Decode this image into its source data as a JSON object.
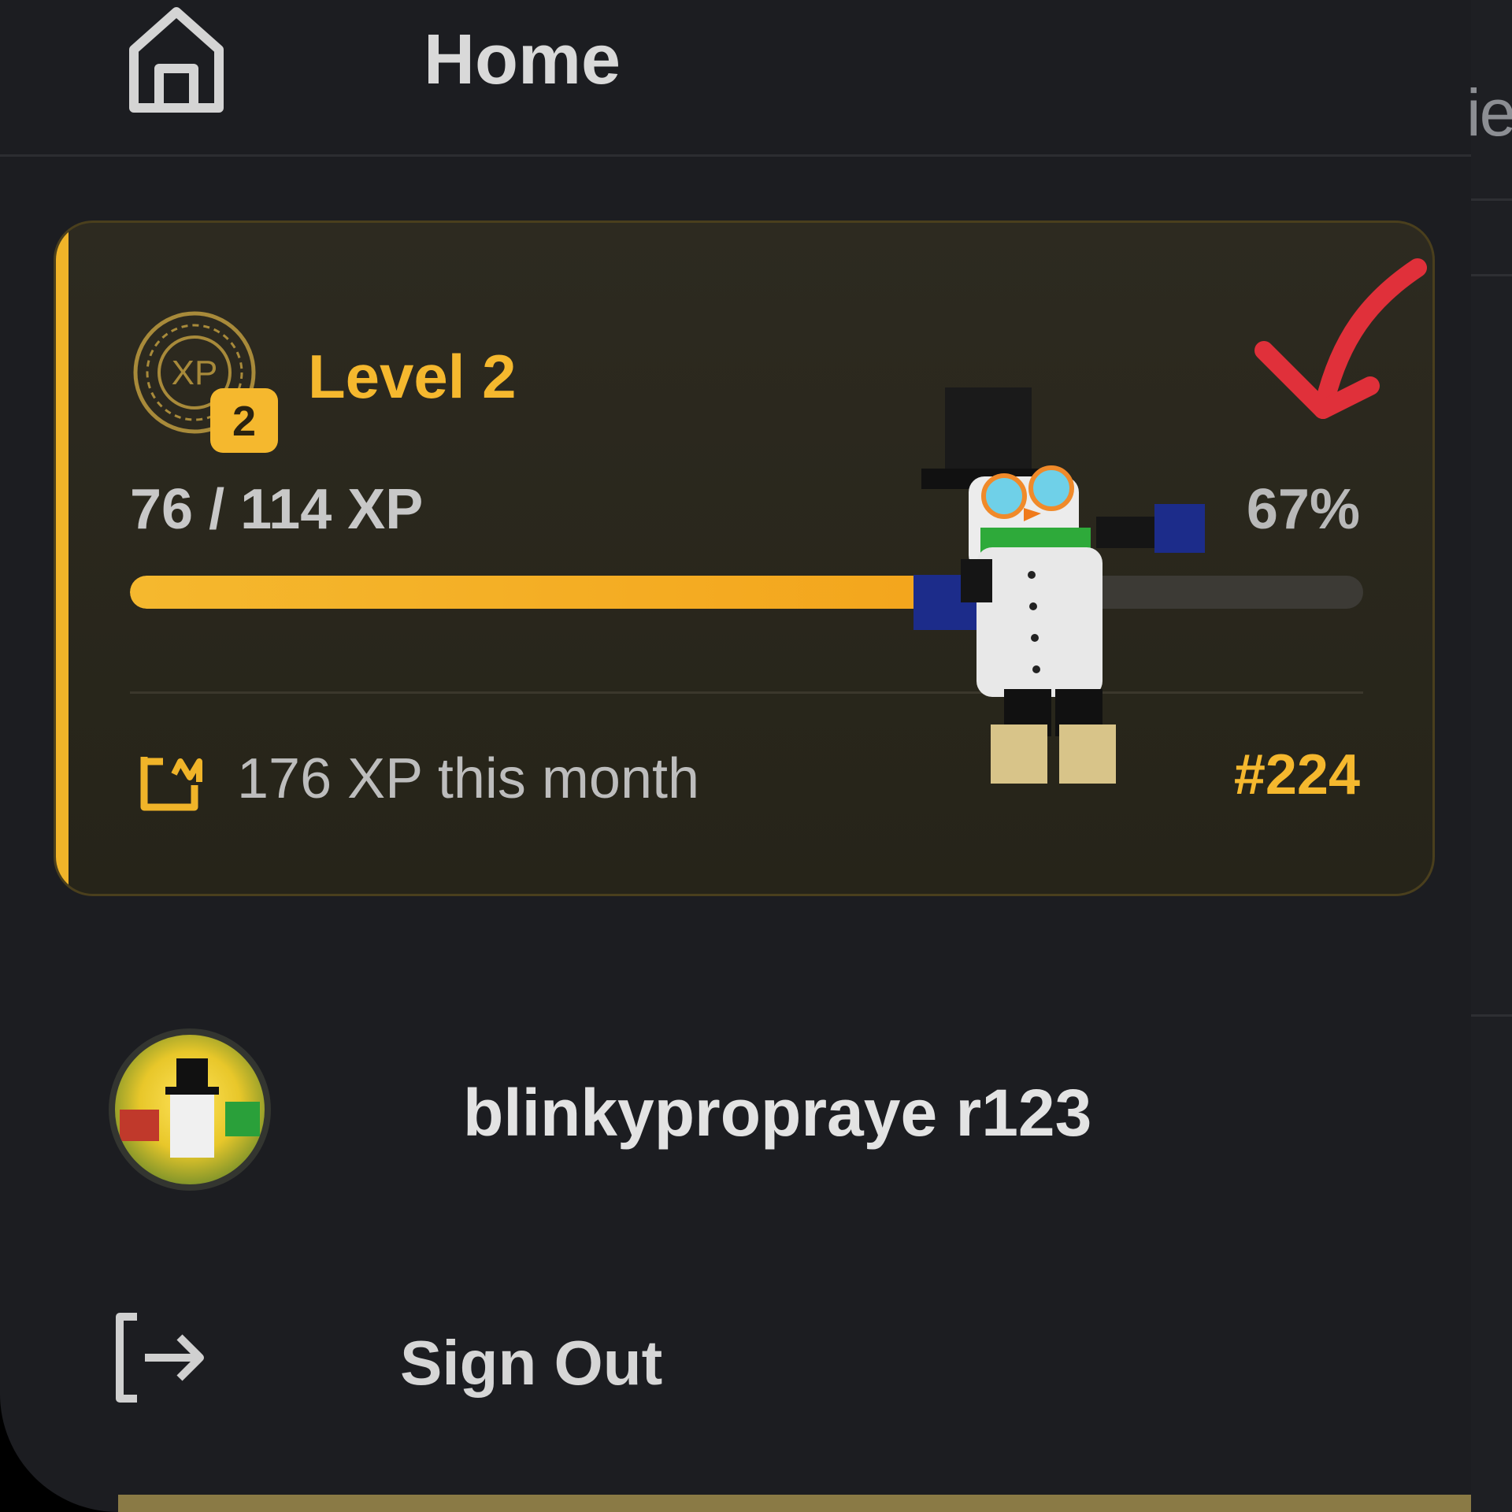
{
  "nav": {
    "home_label": "Home",
    "home_icon": "home-icon"
  },
  "right_edge": {
    "partial_text": "ie"
  },
  "level_card": {
    "badge_icon_text": "XP",
    "badge_level_number": "2",
    "level_title": "Level 2",
    "xp_progress_text": "76 / 114 XP",
    "percent_text": "67%",
    "progress_fraction": 0.67,
    "month_xp_text": "176 XP this month",
    "rank_text": "#224",
    "calendar_icon": "calendar-icon",
    "accent_color": "#f5b82e"
  },
  "user": {
    "username": "blinkypropraye r123"
  },
  "signout": {
    "label": "Sign Out",
    "icon": "sign-out-icon"
  },
  "annotation": {
    "arrow_color": "#e0303a"
  }
}
